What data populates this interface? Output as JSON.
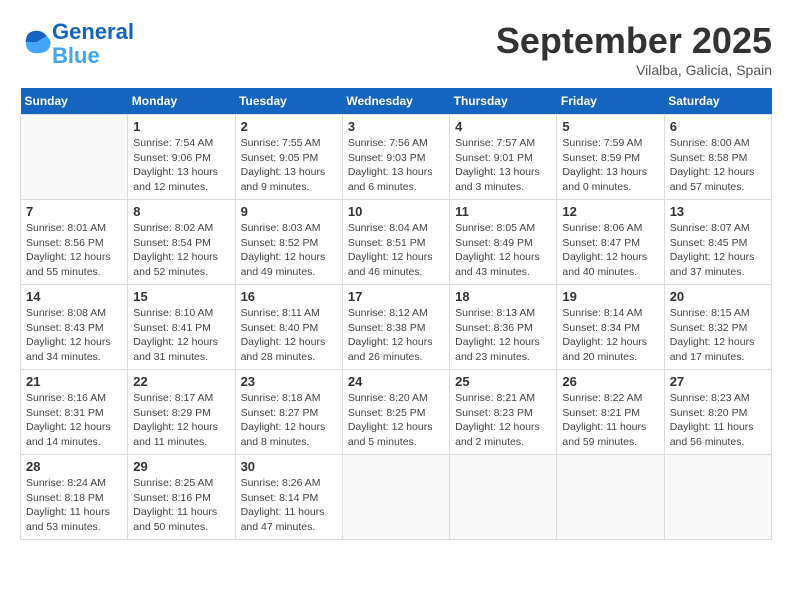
{
  "header": {
    "logo_line1": "General",
    "logo_line2": "Blue",
    "month": "September 2025",
    "location": "Vilalba, Galicia, Spain"
  },
  "days_of_week": [
    "Sunday",
    "Monday",
    "Tuesday",
    "Wednesday",
    "Thursday",
    "Friday",
    "Saturday"
  ],
  "weeks": [
    [
      {
        "day": "",
        "info": ""
      },
      {
        "day": "1",
        "info": "Sunrise: 7:54 AM\nSunset: 9:06 PM\nDaylight: 13 hours\nand 12 minutes."
      },
      {
        "day": "2",
        "info": "Sunrise: 7:55 AM\nSunset: 9:05 PM\nDaylight: 13 hours\nand 9 minutes."
      },
      {
        "day": "3",
        "info": "Sunrise: 7:56 AM\nSunset: 9:03 PM\nDaylight: 13 hours\nand 6 minutes."
      },
      {
        "day": "4",
        "info": "Sunrise: 7:57 AM\nSunset: 9:01 PM\nDaylight: 13 hours\nand 3 minutes."
      },
      {
        "day": "5",
        "info": "Sunrise: 7:59 AM\nSunset: 8:59 PM\nDaylight: 13 hours\nand 0 minutes."
      },
      {
        "day": "6",
        "info": "Sunrise: 8:00 AM\nSunset: 8:58 PM\nDaylight: 12 hours\nand 57 minutes."
      }
    ],
    [
      {
        "day": "7",
        "info": "Sunrise: 8:01 AM\nSunset: 8:56 PM\nDaylight: 12 hours\nand 55 minutes."
      },
      {
        "day": "8",
        "info": "Sunrise: 8:02 AM\nSunset: 8:54 PM\nDaylight: 12 hours\nand 52 minutes."
      },
      {
        "day": "9",
        "info": "Sunrise: 8:03 AM\nSunset: 8:52 PM\nDaylight: 12 hours\nand 49 minutes."
      },
      {
        "day": "10",
        "info": "Sunrise: 8:04 AM\nSunset: 8:51 PM\nDaylight: 12 hours\nand 46 minutes."
      },
      {
        "day": "11",
        "info": "Sunrise: 8:05 AM\nSunset: 8:49 PM\nDaylight: 12 hours\nand 43 minutes."
      },
      {
        "day": "12",
        "info": "Sunrise: 8:06 AM\nSunset: 8:47 PM\nDaylight: 12 hours\nand 40 minutes."
      },
      {
        "day": "13",
        "info": "Sunrise: 8:07 AM\nSunset: 8:45 PM\nDaylight: 12 hours\nand 37 minutes."
      }
    ],
    [
      {
        "day": "14",
        "info": "Sunrise: 8:08 AM\nSunset: 8:43 PM\nDaylight: 12 hours\nand 34 minutes."
      },
      {
        "day": "15",
        "info": "Sunrise: 8:10 AM\nSunset: 8:41 PM\nDaylight: 12 hours\nand 31 minutes."
      },
      {
        "day": "16",
        "info": "Sunrise: 8:11 AM\nSunset: 8:40 PM\nDaylight: 12 hours\nand 28 minutes."
      },
      {
        "day": "17",
        "info": "Sunrise: 8:12 AM\nSunset: 8:38 PM\nDaylight: 12 hours\nand 26 minutes."
      },
      {
        "day": "18",
        "info": "Sunrise: 8:13 AM\nSunset: 8:36 PM\nDaylight: 12 hours\nand 23 minutes."
      },
      {
        "day": "19",
        "info": "Sunrise: 8:14 AM\nSunset: 8:34 PM\nDaylight: 12 hours\nand 20 minutes."
      },
      {
        "day": "20",
        "info": "Sunrise: 8:15 AM\nSunset: 8:32 PM\nDaylight: 12 hours\nand 17 minutes."
      }
    ],
    [
      {
        "day": "21",
        "info": "Sunrise: 8:16 AM\nSunset: 8:31 PM\nDaylight: 12 hours\nand 14 minutes."
      },
      {
        "day": "22",
        "info": "Sunrise: 8:17 AM\nSunset: 8:29 PM\nDaylight: 12 hours\nand 11 minutes."
      },
      {
        "day": "23",
        "info": "Sunrise: 8:18 AM\nSunset: 8:27 PM\nDaylight: 12 hours\nand 8 minutes."
      },
      {
        "day": "24",
        "info": "Sunrise: 8:20 AM\nSunset: 8:25 PM\nDaylight: 12 hours\nand 5 minutes."
      },
      {
        "day": "25",
        "info": "Sunrise: 8:21 AM\nSunset: 8:23 PM\nDaylight: 12 hours\nand 2 minutes."
      },
      {
        "day": "26",
        "info": "Sunrise: 8:22 AM\nSunset: 8:21 PM\nDaylight: 11 hours\nand 59 minutes."
      },
      {
        "day": "27",
        "info": "Sunrise: 8:23 AM\nSunset: 8:20 PM\nDaylight: 11 hours\nand 56 minutes."
      }
    ],
    [
      {
        "day": "28",
        "info": "Sunrise: 8:24 AM\nSunset: 8:18 PM\nDaylight: 11 hours\nand 53 minutes."
      },
      {
        "day": "29",
        "info": "Sunrise: 8:25 AM\nSunset: 8:16 PM\nDaylight: 11 hours\nand 50 minutes."
      },
      {
        "day": "30",
        "info": "Sunrise: 8:26 AM\nSunset: 8:14 PM\nDaylight: 11 hours\nand 47 minutes."
      },
      {
        "day": "",
        "info": ""
      },
      {
        "day": "",
        "info": ""
      },
      {
        "day": "",
        "info": ""
      },
      {
        "day": "",
        "info": ""
      }
    ]
  ]
}
